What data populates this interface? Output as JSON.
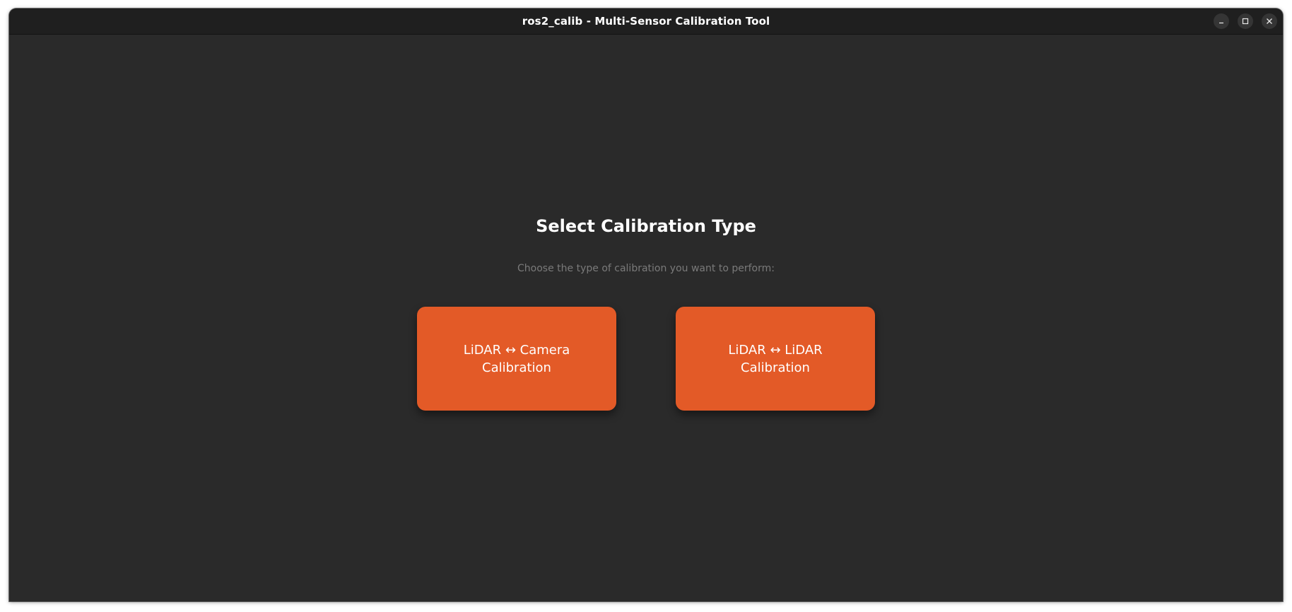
{
  "window": {
    "title": "ros2_calib - Multi-Sensor Calibration Tool",
    "controls": [
      "minimize-icon",
      "maximize-icon",
      "close-icon"
    ]
  },
  "main": {
    "heading": "Select Calibration Type",
    "subtitle": "Choose the type of calibration you want to perform:",
    "options": [
      {
        "label": "LiDAR ↔ Camera\nCalibration"
      },
      {
        "label": "LiDAR ↔ LiDAR\nCalibration"
      }
    ]
  },
  "colors": {
    "background": "#2a2a2a",
    "titlebar": "#1f1f1f",
    "accent": "#e35a27",
    "subtitle": "#7a7a7a"
  }
}
